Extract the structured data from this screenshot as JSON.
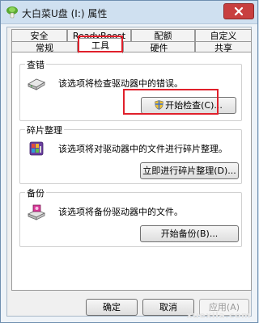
{
  "window": {
    "title": "大白菜U盘 (I:) 属性"
  },
  "tabs": {
    "row1": [
      "安全",
      "ReadyBoost",
      "配额",
      "自定义"
    ],
    "row2": [
      "常规",
      "工具",
      "硬件",
      "共享"
    ]
  },
  "check": {
    "title": "查错",
    "description": "该选项将检查驱动器中的错误。",
    "button": "开始检查(C)..."
  },
  "defrag": {
    "title": "碎片整理",
    "description": "该选项将对驱动器中的文件进行碎片整理。",
    "button": "立即进行碎片整理(D)..."
  },
  "backup": {
    "title": "备份",
    "description": "该选项将备份驱动器中的文件。",
    "button": "开始备份(B)..."
  },
  "footer": {
    "ok": "确定",
    "cancel": "取消",
    "apply": "应用(A)"
  },
  "watermark": "xuexila.com",
  "highlight_color": "#e0202b"
}
